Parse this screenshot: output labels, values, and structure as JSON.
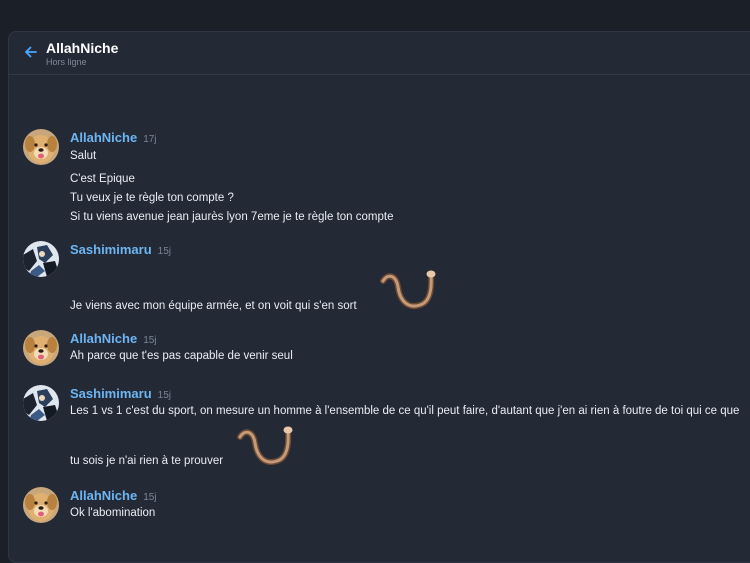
{
  "header": {
    "title": "AllahNiche",
    "status": "Hors ligne"
  },
  "colors": {
    "accent": "#6db5f2",
    "background": "#232a36"
  },
  "icons": {
    "back": "arrow-left-icon",
    "sticker": "noodle-sticker"
  },
  "messages": [
    {
      "author": "AllahNiche",
      "time": "17j",
      "lines": [
        "Salut",
        "C'est Epique",
        "Tu veux je te règle ton compte ?",
        "Si tu viens avenue jean jaurès lyon 7eme je te règle ton compte"
      ]
    },
    {
      "author": "Sashimimaru",
      "time": "15j",
      "lines": [
        "Je viens avec mon équipe armée, et on voit qui s'en sort"
      ]
    },
    {
      "author": "AllahNiche",
      "time": "15j",
      "lines": [
        "Ah parce que t'es pas capable de venir seul"
      ]
    },
    {
      "author": "Sashimimaru",
      "time": "15j",
      "lines": [
        "Les 1 vs 1 c'est du sport, on mesure un homme à l'ensemble de ce qu'il peut faire, d'autant que j'en ai rien à foutre de toi qui ce que",
        "tu sois je n'ai rien à te prouver"
      ]
    },
    {
      "author": "AllahNiche",
      "time": "15j",
      "lines": [
        "Ok l'abomination"
      ]
    }
  ]
}
